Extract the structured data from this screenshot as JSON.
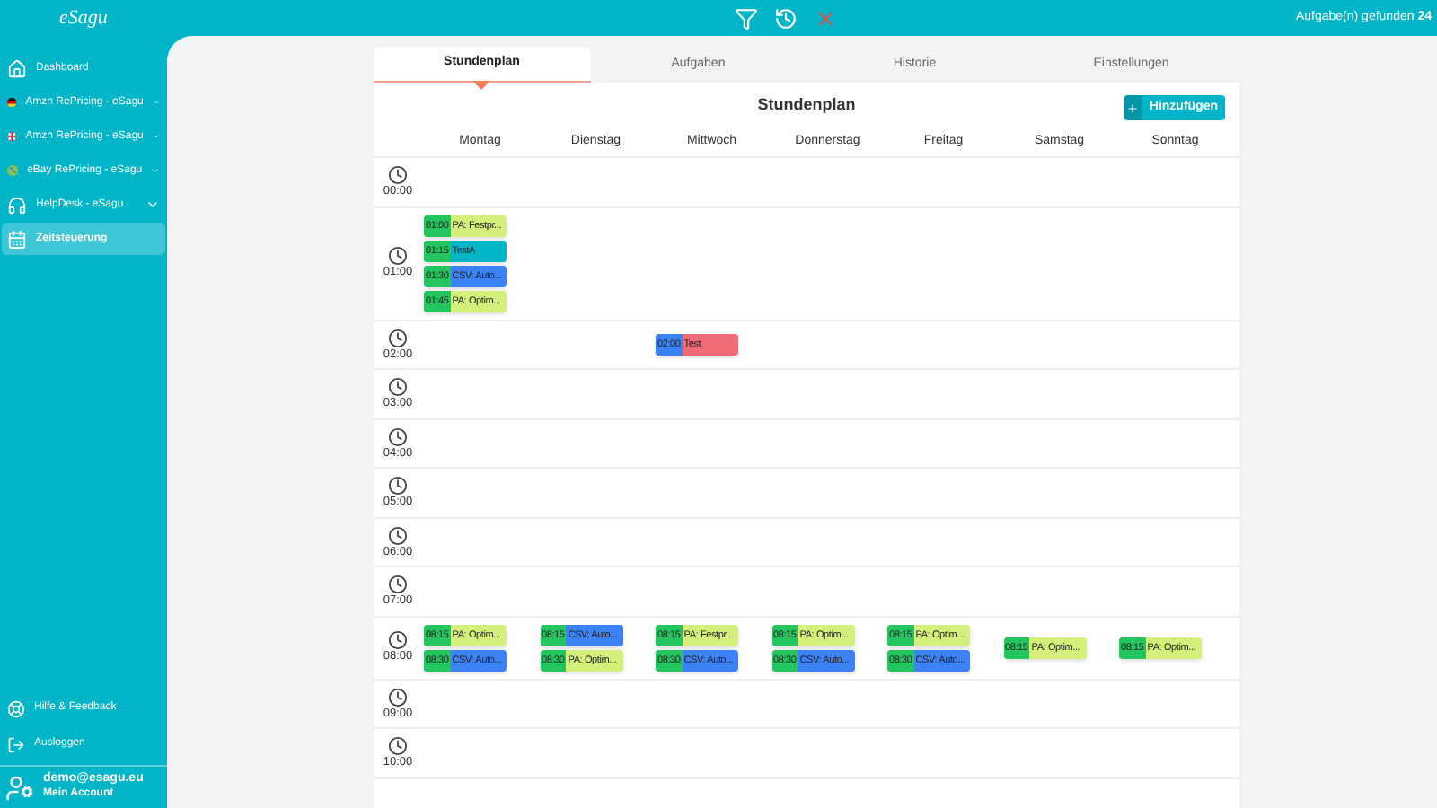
{
  "top_bar": {
    "logo": "eSagu",
    "found_label": "Aufgabe(n) gefunden",
    "found_count": "24"
  },
  "sidebar": {
    "items": [
      {
        "label": "Dashboard",
        "expandable": false,
        "selected": false
      },
      {
        "label": "Amzn RePricing - eSagu",
        "expandable": true,
        "selected": false
      },
      {
        "label": "Amzn RePricing - eSagu",
        "expandable": true,
        "selected": false
      },
      {
        "label": "eBay RePricing - eSagu",
        "expandable": true,
        "selected": false
      },
      {
        "label": "HelpDesk - eSagu",
        "expandable": true,
        "selected": false
      },
      {
        "label": "Zeitsteuerung",
        "expandable": false,
        "selected": true
      }
    ],
    "bottom_items": [
      {
        "label": "Hilfe & Feedback"
      },
      {
        "label": "Ausloggen"
      }
    ],
    "account": {
      "email": "demo@esagu.eu",
      "label": "Mein Account"
    }
  },
  "tabs": [
    {
      "label": "Stundenplan",
      "selected": true
    },
    {
      "label": "Aufgaben",
      "selected": false
    },
    {
      "label": "Historie",
      "selected": false
    },
    {
      "label": "Einstellungen",
      "selected": false
    }
  ],
  "schedule": {
    "title": "Stundenplan",
    "add_button": "Hinzufügen",
    "days": [
      "Montag",
      "Dienstag",
      "Mittwoch",
      "Donnerstag",
      "Freitag",
      "Samstag",
      "Sonntag"
    ],
    "rows": [
      {
        "time": "00:00",
        "cells": [
          [],
          [],
          [],
          [],
          [],
          [],
          []
        ]
      },
      {
        "time": "01:00",
        "cells": [
          [
            {
              "time": "01:00",
              "title": "PA: Festpr...",
              "active": true,
              "color": "#d4f07a"
            },
            {
              "time": "01:15",
              "title": "TestA",
              "active": true,
              "color": "#00b5c8"
            },
            {
              "time": "01:30",
              "title": "CSV: Auto...",
              "active": true,
              "color": "#3b82f6"
            },
            {
              "time": "01:45",
              "title": "PA: Optim...",
              "active": true,
              "color": "#d4f07a"
            }
          ],
          [],
          [],
          [],
          [],
          [],
          []
        ]
      },
      {
        "time": "02:00",
        "cells": [
          [],
          [],
          [
            {
              "time": "02:00",
              "title": "Test",
              "active": false,
              "color": "#ee6b77"
            }
          ],
          [],
          [],
          [],
          []
        ]
      },
      {
        "time": "03:00",
        "cells": [
          [],
          [],
          [],
          [],
          [],
          [],
          []
        ]
      },
      {
        "time": "04:00",
        "cells": [
          [],
          [],
          [],
          [],
          [],
          [],
          []
        ]
      },
      {
        "time": "05:00",
        "cells": [
          [],
          [],
          [],
          [],
          [],
          [],
          []
        ]
      },
      {
        "time": "06:00",
        "cells": [
          [],
          [],
          [],
          [],
          [],
          [],
          []
        ]
      },
      {
        "time": "07:00",
        "cells": [
          [],
          [],
          [],
          [],
          [],
          [],
          []
        ]
      },
      {
        "time": "08:00",
        "cells": [
          [
            {
              "time": "08:15",
              "title": "PA: Optim...",
              "active": true,
              "color": "#d4f07a"
            },
            {
              "time": "08:30",
              "title": "CSV: Auto...",
              "active": true,
              "color": "#3b82f6"
            }
          ],
          [
            {
              "time": "08:15",
              "title": "CSV: Auto...",
              "active": true,
              "color": "#3b82f6"
            },
            {
              "time": "08:30",
              "title": "PA: Optim...",
              "active": true,
              "color": "#d4f07a"
            }
          ],
          [
            {
              "time": "08:15",
              "title": "PA: Festpr...",
              "active": true,
              "color": "#d4f07a"
            },
            {
              "time": "08:30",
              "title": "CSV: Auto...",
              "active": true,
              "color": "#3b82f6"
            }
          ],
          [
            {
              "time": "08:15",
              "title": "PA: Optim...",
              "active": true,
              "color": "#d4f07a"
            },
            {
              "time": "08:30",
              "title": "CSV: Auto...",
              "active": true,
              "color": "#3b82f6"
            }
          ],
          [
            {
              "time": "08:15",
              "title": "PA: Optim...",
              "active": true,
              "color": "#d4f07a"
            },
            {
              "time": "08:30",
              "title": "CSV: Auto...",
              "active": true,
              "color": "#3b82f6"
            }
          ],
          [
            {
              "time": "08:15",
              "title": "PA: Optim...",
              "active": true,
              "color": "#d4f07a"
            }
          ],
          [
            {
              "time": "08:15",
              "title": "PA: Optim...",
              "active": true,
              "color": "#d4f07a"
            }
          ]
        ]
      },
      {
        "time": "09:00",
        "cells": [
          [],
          [],
          [],
          [],
          [],
          [],
          []
        ]
      },
      {
        "time": "10:00",
        "cells": [
          [],
          [],
          [],
          [],
          [],
          [],
          []
        ]
      }
    ]
  }
}
